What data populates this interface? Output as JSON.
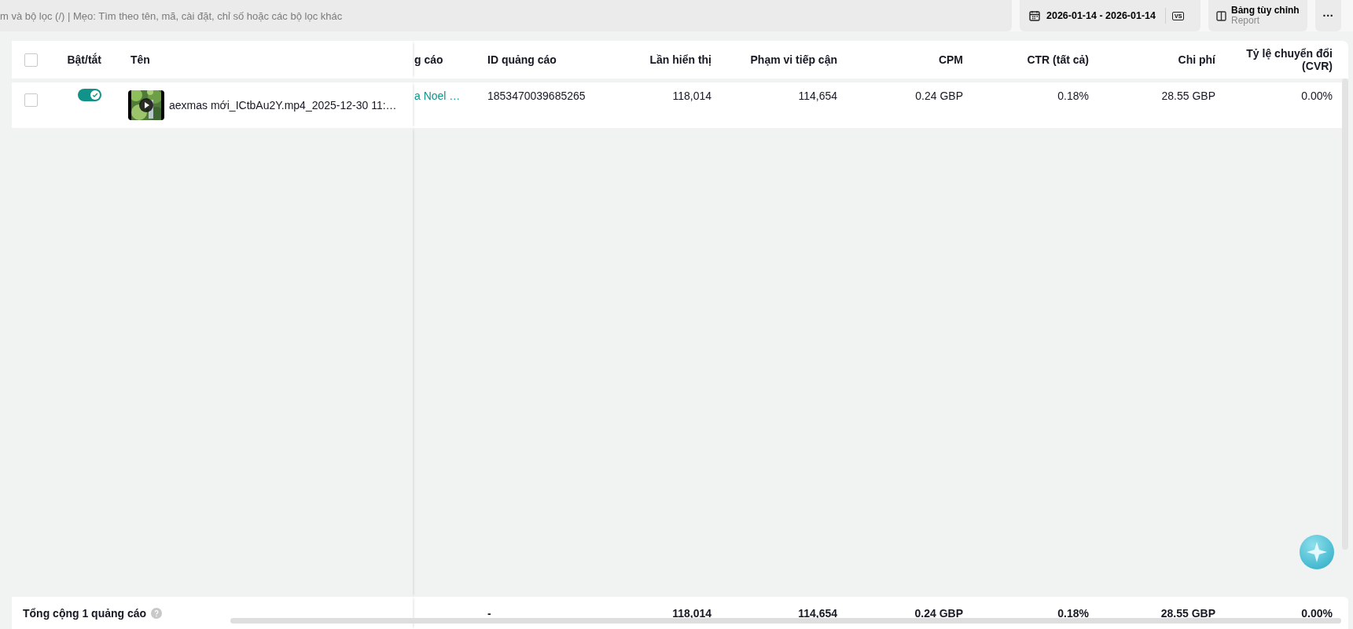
{
  "search": {
    "placeholder": "m và bộ lọc (/) | Mẹo: Tìm theo tên, mã, cài đặt, chỉ số hoặc các bộ lọc khác"
  },
  "toolbar": {
    "date_range": "2026-01-14 - 2026-01-14",
    "compare": "VS",
    "custom_table": {
      "label": "Bảng tùy chỉnh",
      "sublabel": "Report"
    },
    "more": "···"
  },
  "table": {
    "header_checked": false,
    "fixed_columns": [
      {
        "label": "Bật/tắt"
      },
      {
        "label": "Tên"
      }
    ],
    "columns": [
      {
        "label": "g cáo",
        "kind": "text"
      },
      {
        "label": "ID quảng cáo",
        "kind": "text"
      },
      {
        "label": "Lần hiển thị",
        "kind": "number"
      },
      {
        "label": "Phạm vi tiếp cận",
        "kind": "number"
      },
      {
        "label": "CPM",
        "kind": "number"
      },
      {
        "label": "CTR (tất cả)",
        "kind": "number"
      },
      {
        "label": "Chi phí",
        "kind": "number"
      },
      {
        "label": "Tỷ lệ chuyển đổi (CVR)",
        "kind": "number"
      }
    ],
    "rows": [
      {
        "checked": false,
        "on": true,
        "name": "aexmas mới_ICtbAu2Y.mp4_2025-12-30 11:…",
        "cells": [
          "a Noel …",
          "1853470039685265",
          "118,014",
          "114,654",
          "0.24 GBP",
          "0.18%",
          "28.55 GBP",
          "0.00%"
        ]
      }
    ],
    "total": {
      "label": "Tổng cộng 1 quảng cáo",
      "cells": [
        "",
        "-",
        "118,014",
        "114,654",
        "0.24 GBP",
        "0.18%",
        "28.55 GBP",
        "0.00%"
      ]
    }
  }
}
